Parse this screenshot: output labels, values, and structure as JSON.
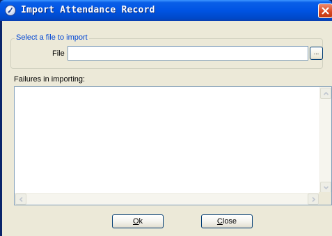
{
  "window": {
    "title": "Import Attendance Record"
  },
  "group": {
    "legend": "Select a file to import"
  },
  "file": {
    "label": "File",
    "value": "",
    "browse_label": "..."
  },
  "failures": {
    "label": "Failures in importing:",
    "items": []
  },
  "buttons": {
    "ok_mnemonic": "O",
    "ok_rest": "k",
    "close_mnemonic": "C",
    "close_rest": "lose"
  },
  "colors": {
    "titlebar": "#0054e3",
    "client": "#ece9d8",
    "legend_text": "#0046d5",
    "close_button": "#d8451e"
  }
}
